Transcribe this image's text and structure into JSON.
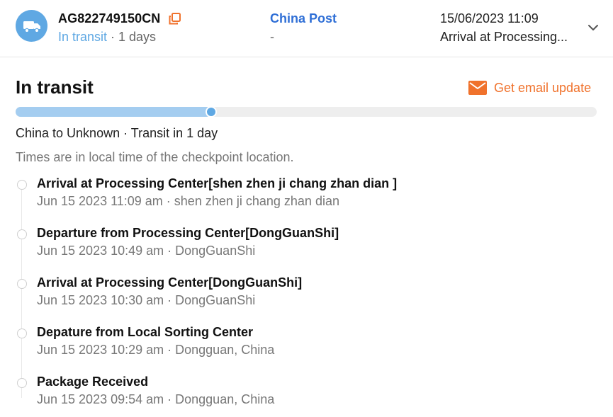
{
  "header": {
    "tracking_number": "AG822749150CN",
    "status": "In transit",
    "duration": " · 1 days",
    "carrier_name": "China Post",
    "carrier_sub": "-",
    "last_update_time": "15/06/2023 11:09",
    "last_event": "Arrival at Processing...",
    "icons": {
      "carrier": "truck-icon",
      "copy": "copy-icon",
      "expand": "chevron-down-icon"
    }
  },
  "details": {
    "title": "In transit",
    "email_button_label": "Get email update",
    "progress_fraction": 0.337,
    "route": "China to Unknown · Transit in 1 day",
    "timezone_note": "Times are in local time of the checkpoint location.",
    "colors": {
      "accent": "#5fa8e3",
      "carrier": "#2f6fd6",
      "email": "#f0722c"
    }
  },
  "events": [
    {
      "title": "Arrival at Processing Center[shen zhen ji chang zhan dian ]",
      "subtitle": "Jun 15 2023 11:09 am · shen zhen ji chang zhan dian"
    },
    {
      "title": "Departure from Processing Center[DongGuanShi]",
      "subtitle": "Jun 15 2023 10:49 am · DongGuanShi"
    },
    {
      "title": "Arrival at Processing Center[DongGuanShi]",
      "subtitle": "Jun 15 2023 10:30 am · DongGuanShi"
    },
    {
      "title": "Depature from Local Sorting Center",
      "subtitle": "Jun 15 2023 10:29 am · Dongguan, China"
    },
    {
      "title": "Package Received",
      "subtitle": "Jun 15 2023 09:54 am · Dongguan, China"
    }
  ]
}
